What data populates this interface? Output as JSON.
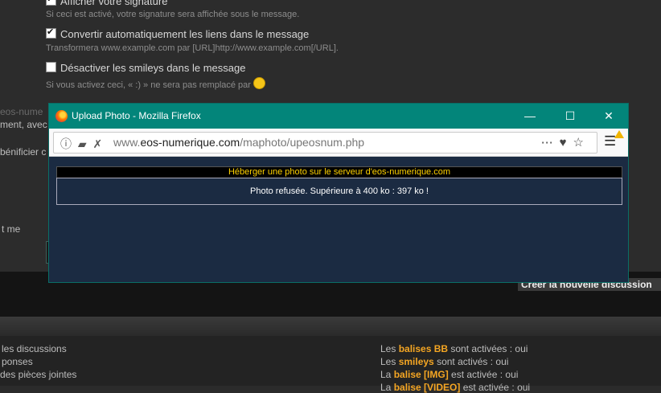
{
  "options": [
    {
      "label": "Afficher votre signature",
      "checked": true,
      "hint": "Si ceci est activé, votre signature sera affichée sous le message."
    },
    {
      "label": "Convertir automatiquement les liens dans le message",
      "checked": true,
      "hint": "Transformera www.example.com par [URL]http://www.example.com[/URL]."
    },
    {
      "label": "Désactiver les smileys dans le message",
      "checked": false,
      "hint": "Si vous activez ceci, « :) » ne sera pas remplacé par"
    }
  ],
  "side_texts": [
    "eos-nume",
    "ment, avec",
    "bénificier c",
    "t me"
  ],
  "create_button": "Créer la nouvelle discussion",
  "footer_left": [
    "les discussions",
    "ponses",
    " des pièces jointes"
  ],
  "footer_right": [
    {
      "pre": "Les ",
      "bold": "balises BB",
      "post": " sont activées : oui"
    },
    {
      "pre": "Les ",
      "bold": "smileys",
      "post": " sont activés : oui"
    },
    {
      "pre": "La ",
      "bold": "balise [IMG]",
      "post": " est activée : oui"
    },
    {
      "pre": "La ",
      "bold": "balise [VIDEO]",
      "post": " est activée : oui"
    }
  ],
  "window": {
    "title": "Upload Photo - Mozilla Firefox",
    "controls": {
      "minimize": "—",
      "maximize": "☐",
      "close": "✕"
    },
    "url_prefix": "www.",
    "url_domain": "eos-numerique.com",
    "url_path": "/maphoto/upeosnum.php",
    "banner": "Héberger une photo sur le serveur d'eos-numerique.com",
    "message": "Photo refusée. Supérieure à 400 ko : 397 ko !"
  },
  "colors": {
    "titlebar": "#03857a",
    "content_bg": "#1b2b42",
    "banner_text": "#ffd200",
    "footer_highlight": "#f5a623"
  }
}
